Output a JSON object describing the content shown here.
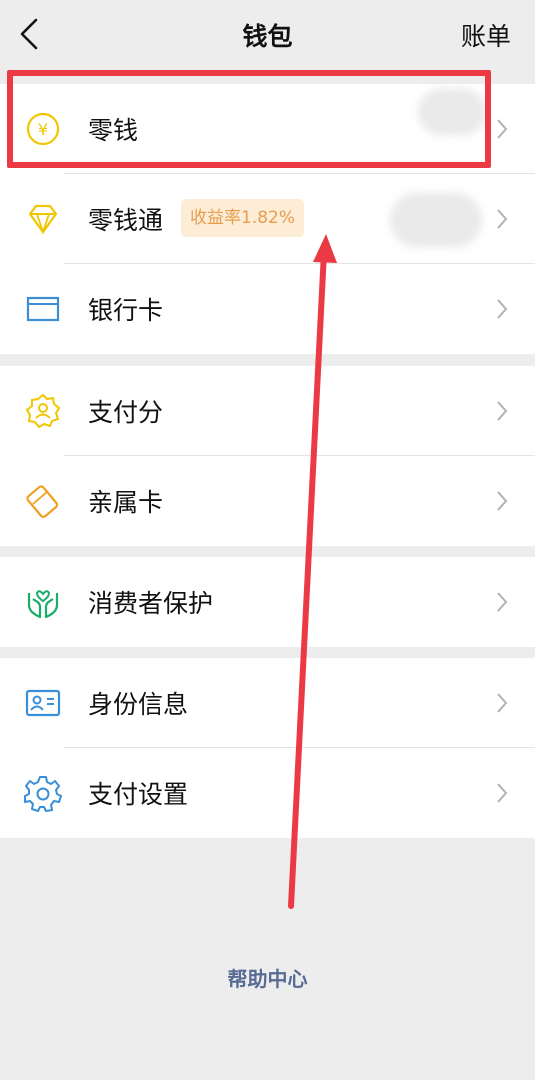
{
  "nav": {
    "title": "钱包",
    "right_action": "账单",
    "back_icon": "chevron-left-icon"
  },
  "wallet_items": [
    {
      "label": "零钱",
      "icon": "yuan-coin-icon",
      "color": "#f0c600"
    },
    {
      "label": "零钱通",
      "icon": "diamond-icon",
      "color": "#f0c600",
      "badge": "收益率1.82%"
    },
    {
      "label": "银行卡",
      "icon": "bank-card-icon",
      "color": "#3a8fd6"
    }
  ],
  "credit_items": [
    {
      "label": "支付分",
      "icon": "pay-score-icon",
      "color": "#f0c600"
    },
    {
      "label": "亲属卡",
      "icon": "family-card-icon",
      "color": "#f0a020"
    }
  ],
  "protection_items": [
    {
      "label": "消费者保护",
      "icon": "hands-protect-icon",
      "color": "#1aad69"
    }
  ],
  "settings_items": [
    {
      "label": "身份信息",
      "icon": "id-card-icon",
      "color": "#3a8fd6"
    },
    {
      "label": "支付设置",
      "icon": "gear-icon",
      "color": "#3a8fd6"
    }
  ],
  "footer": {
    "help_link": "帮助中心"
  },
  "annotation": {
    "highlight_color": "#ec3a45"
  }
}
